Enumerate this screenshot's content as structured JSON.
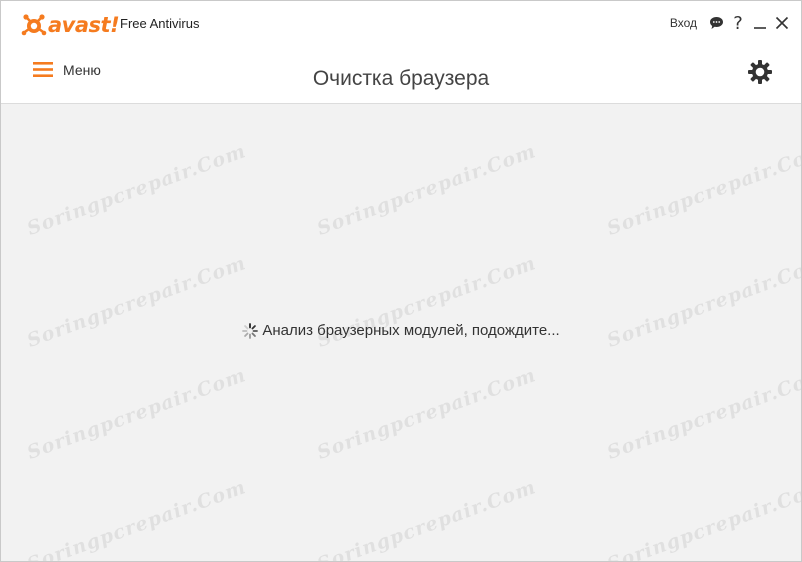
{
  "app": {
    "logo_text": "avast!",
    "product_name": "Free Antivirus",
    "brand_color": "#f57b1f"
  },
  "top_bar": {
    "login_label": "Вход",
    "chat_icon": "chat-bubble-icon",
    "help_label": "?",
    "minimize_icon": "minimize-icon",
    "close_icon": "close-icon"
  },
  "nav": {
    "menu_label": "Меню",
    "menu_icon": "hamburger-icon"
  },
  "page": {
    "title": "Очистка браузера",
    "settings_icon": "gear-icon"
  },
  "status": {
    "message": "Анализ браузерных модулей, подождите...",
    "spinner_icon": "loading-spinner-icon"
  },
  "watermark": {
    "text": "Soringpcrepair.Com"
  }
}
